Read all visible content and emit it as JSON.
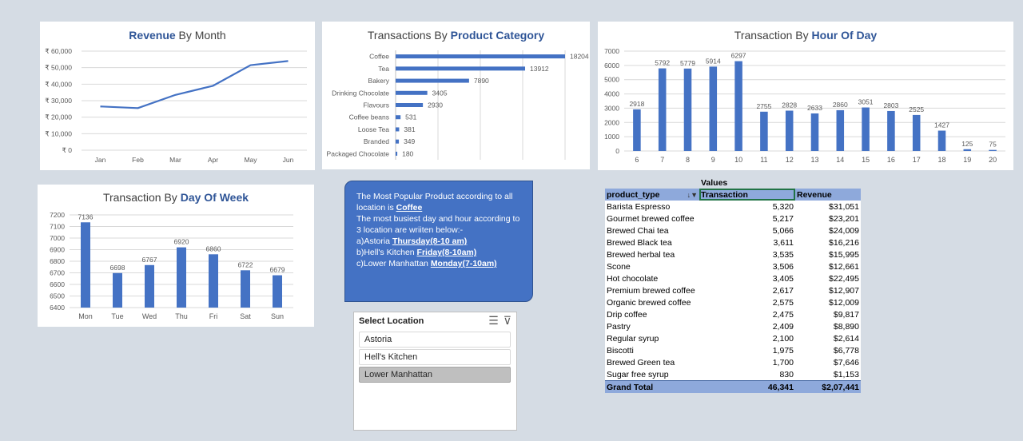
{
  "colors": {
    "bar": "#4472c4",
    "accent": "#2f5597",
    "grid": "#d9d9d9",
    "axis_text": "#595959",
    "callout_bg": "#4472c4",
    "pivot_header_bg": "#8ea9db"
  },
  "chart_data": [
    {
      "id": "revenue_by_month",
      "type": "line",
      "title_plain": "",
      "title_highlight": "Revenue",
      "title_suffix": " By Month",
      "categories": [
        "Jan",
        "Feb",
        "Mar",
        "Apr",
        "May",
        "Jun"
      ],
      "values": [
        26500,
        25500,
        33500,
        39000,
        51500,
        54000
      ],
      "yticks": [
        "₹ 0",
        "₹ 10,000",
        "₹ 20,000",
        "₹ 30,000",
        "₹ 40,000",
        "₹ 50,000",
        "₹ 60,000"
      ],
      "ylim": [
        0,
        60000
      ],
      "grid": true
    },
    {
      "id": "transactions_by_product_category",
      "type": "bar",
      "orientation": "horizontal",
      "title_plain": "Transactions By ",
      "title_highlight": "Product Category",
      "title_suffix": "",
      "categories": [
        "Coffee",
        "Tea",
        "Bakery",
        "Drinking Chocolate",
        "Flavours",
        "Coffee beans",
        "Loose Tea",
        "Branded",
        "Packaged Chocolate"
      ],
      "values": [
        18204,
        13912,
        7890,
        3405,
        2930,
        531,
        381,
        349,
        180
      ],
      "data_labels": [
        "18204",
        "13912",
        "7890",
        "3405",
        "2930",
        "531",
        "381",
        "349",
        "180"
      ],
      "xlim": [
        0,
        18204
      ],
      "grid": true
    },
    {
      "id": "transaction_by_hour_of_day",
      "type": "bar",
      "title_plain": "Transaction By ",
      "title_highlight": "Hour Of Day",
      "title_suffix": "",
      "categories": [
        "6",
        "7",
        "8",
        "9",
        "10",
        "11",
        "12",
        "13",
        "14",
        "15",
        "16",
        "17",
        "18",
        "19",
        "20"
      ],
      "values": [
        2918,
        5792,
        5779,
        5914,
        6297,
        2755,
        2828,
        2633,
        2860,
        3051,
        2803,
        2525,
        1427,
        125,
        75
      ],
      "data_labels": [
        "2918",
        "5792",
        "5779",
        "5914",
        "6297",
        "2755",
        "2828",
        "2633",
        "2860",
        "3051",
        "2803",
        "2525",
        "1427",
        "125",
        "75"
      ],
      "yticks": [
        "0",
        "1000",
        "2000",
        "3000",
        "4000",
        "5000",
        "6000",
        "7000"
      ],
      "ylim": [
        0,
        7000
      ],
      "grid": true
    },
    {
      "id": "transaction_by_day_of_week",
      "type": "bar",
      "title_plain": "Transaction By ",
      "title_highlight": "Day Of Week",
      "title_suffix": "",
      "categories": [
        "Mon",
        "Tue",
        "Wed",
        "Thu",
        "Fri",
        "Sat",
        "Sun"
      ],
      "values": [
        7136,
        6698,
        6767,
        6920,
        6860,
        6722,
        6679
      ],
      "data_labels": [
        "7136",
        "6698",
        "6767",
        "6920",
        "6860",
        "6722",
        "6679"
      ],
      "yticks": [
        "6400",
        "6500",
        "6600",
        "6700",
        "6800",
        "6900",
        "7000",
        "7100",
        "7200"
      ],
      "ylim": [
        6400,
        7200
      ],
      "grid": true
    }
  ],
  "callout": {
    "line1": "The Most Popular Product according to all location is ",
    "popular": "Coffee",
    "line2": "The most busiest day and hour according to 3 location are wriiten below:-",
    "a_prefix": "a)Astoria ",
    "a_value": "Thursday(8-10 am)",
    "b_prefix": "b)Hell's Kitchen ",
    "b_value": "Friday(8-10am)",
    "c_prefix": "c)Lower Manhattan ",
    "c_value": "Monday(7-10am)"
  },
  "slicer": {
    "title": "Select Location",
    "items": [
      {
        "label": "Astoria",
        "selected": false
      },
      {
        "label": "Hell's Kitchen",
        "selected": false
      },
      {
        "label": "Lower Manhattan",
        "selected": true
      }
    ]
  },
  "pivot": {
    "values_header": "Values",
    "col_product": "product_type",
    "col_transaction": "Transaction",
    "col_revenue": "Revenue",
    "rows": [
      {
        "name": "Barista Espresso",
        "transaction": "5,320",
        "revenue": "$31,051"
      },
      {
        "name": "Gourmet brewed coffee",
        "transaction": "5,217",
        "revenue": "$23,201"
      },
      {
        "name": "Brewed Chai tea",
        "transaction": "5,066",
        "revenue": "$24,009"
      },
      {
        "name": "Brewed Black tea",
        "transaction": "3,611",
        "revenue": "$16,216"
      },
      {
        "name": "Brewed herbal tea",
        "transaction": "3,535",
        "revenue": "$15,995"
      },
      {
        "name": "Scone",
        "transaction": "3,506",
        "revenue": "$12,661"
      },
      {
        "name": "Hot chocolate",
        "transaction": "3,405",
        "revenue": "$22,495"
      },
      {
        "name": "Premium brewed coffee",
        "transaction": "2,617",
        "revenue": "$12,907"
      },
      {
        "name": "Organic brewed coffee",
        "transaction": "2,575",
        "revenue": "$12,009"
      },
      {
        "name": "Drip coffee",
        "transaction": "2,475",
        "revenue": "$9,817"
      },
      {
        "name": "Pastry",
        "transaction": "2,409",
        "revenue": "$8,890"
      },
      {
        "name": "Regular syrup",
        "transaction": "2,100",
        "revenue": "$2,614"
      },
      {
        "name": "Biscotti",
        "transaction": "1,975",
        "revenue": "$6,778"
      },
      {
        "name": "Brewed Green tea",
        "transaction": "1,700",
        "revenue": "$7,646"
      },
      {
        "name": "Sugar free syrup",
        "transaction": "830",
        "revenue": "$1,153"
      }
    ],
    "total_label": "Grand Total",
    "total_transaction": "46,341",
    "total_revenue": "$2,07,441"
  }
}
